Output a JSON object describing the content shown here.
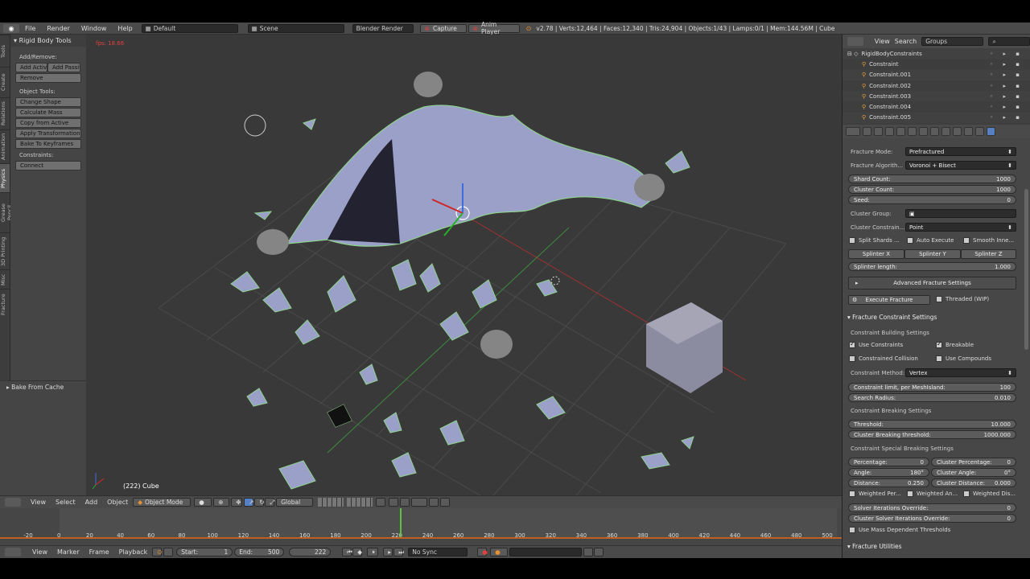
{
  "topbar": {
    "menus": [
      "File",
      "Render",
      "Window",
      "Help"
    ],
    "layout": "Default",
    "scene": "Scene",
    "engine": "Blender Render",
    "capture": "Capture",
    "anim_player": "Anim Player",
    "stats": "v2.78 | Verts:12,464 | Faces:12,340 | Tris:24,904 | Objects:1/43 | Lamps:0/1 | Mem:144.56M | Cube"
  },
  "vtabs": [
    "Tools",
    "Create",
    "Relations",
    "Animation",
    "Physics",
    "Grease Pencil",
    "3D Printing",
    "Misc",
    "Fracture"
  ],
  "toolshelf": {
    "title": "Rigid Body Tools",
    "addremove_label": "Add/Remove:",
    "add_active": "Add Activ",
    "add_passive": "Add Passiv",
    "remove": "Remove",
    "object_tools_label": "Object Tools:",
    "object_tools": [
      "Change Shape",
      "Calculate Mass",
      "Copy from Active",
      "Apply Transformation",
      "Bake To Keyframes"
    ],
    "constraints_label": "Constraints:",
    "connect": "Connect",
    "bake_cache": "Bake From Cache"
  },
  "viewport": {
    "fps": "fps: 18.66",
    "object_label": "(222) Cube"
  },
  "viewheader": {
    "menus": [
      "View",
      "Select",
      "Add",
      "Object"
    ],
    "mode": "Object Mode",
    "orientation": "Global"
  },
  "timeline": {
    "ticks": [
      "-20",
      "0",
      "20",
      "40",
      "60",
      "80",
      "100",
      "120",
      "140",
      "160",
      "180",
      "200",
      "220",
      "240",
      "260",
      "280",
      "300",
      "320",
      "340",
      "360",
      "380",
      "400",
      "420",
      "440",
      "460",
      "480",
      "500"
    ],
    "menus": [
      "View",
      "Marker",
      "Frame",
      "Playback"
    ],
    "start_label": "Start:",
    "start": "1",
    "end_label": "End:",
    "end": "500",
    "current": "222",
    "sync": "No Sync"
  },
  "outliner": {
    "menus": [
      "View",
      "Search"
    ],
    "filter": "Groups",
    "rows": [
      "RigidBodyConstraints",
      "Constraint",
      "Constraint.001",
      "Constraint.002",
      "Constraint.003",
      "Constraint.004",
      "Constraint.005"
    ]
  },
  "props": {
    "fracture_mode_label": "Fracture Mode:",
    "fracture_mode": "Prefractured",
    "fracture_algo_label": "Fracture Algorith...",
    "fracture_algo": "Voronoi + Bisect",
    "shard_count_label": "Shard Count:",
    "shard_count": "1000",
    "cluster_count_label": "Cluster Count:",
    "cluster_count": "1000",
    "seed_label": "Seed:",
    "seed": "0",
    "cluster_group_label": "Cluster Group:",
    "cluster_constraint_label": "Cluster Constrain...",
    "cluster_constraint": "Point",
    "split_shards": "Split Shards ...",
    "auto_execute": "Auto Execute",
    "smooth_inner": "Smooth Inne...",
    "splinter_x": "Splinter X",
    "splinter_y": "Splinter Y",
    "splinter_z": "Splinter Z",
    "splinter_length_label": "Splinter length:",
    "splinter_length": "1.000",
    "advanced": "Advanced Fracture Settings",
    "execute": "Execute Fracture",
    "threaded": "Threaded (WIP)",
    "constraint_settings": "Fracture Constraint Settings",
    "building_settings": "Constraint Building Settings",
    "use_constraints": "Use Constraints",
    "breakable": "Breakable",
    "constrained_collision": "Constrained Collision",
    "use_compounds": "Use Compounds",
    "constraint_method_label": "Constraint Method:",
    "constraint_method": "Vertex",
    "constraint_limit_label": "Constraint limit, per MeshIsland:",
    "constraint_limit": "100",
    "search_radius_label": "Search Radius:",
    "search_radius": "0.010",
    "breaking_settings": "Constraint Breaking Settings",
    "threshold_label": "Threshold:",
    "threshold": "10.000",
    "cluster_threshold_label": "Cluster Breaking threshold:",
    "cluster_threshold": "1000.000",
    "special_settings": "Constraint Special Breaking Settings",
    "percentage_label": "Percentage:",
    "percentage": "0",
    "cluster_percentage_label": "Cluster Percentage:",
    "cluster_percentage": "0",
    "angle_label": "Angle:",
    "angle": "180°",
    "cluster_angle_label": "Cluster Angle:",
    "cluster_angle": "0°",
    "distance_label": "Distance:",
    "distance": "0.250",
    "cluster_distance_label": "Cluster Distance:",
    "cluster_distance": "0.000",
    "weighted_per": "Weighted Per...",
    "weighted_an": "Weighted An...",
    "weighted_dis": "Weighted Dis...",
    "solver_iter_label": "Solver Iterations Override:",
    "solver_iter": "0",
    "cluster_solver_iter_label": "Cluster Solver Iterations Override:",
    "cluster_solver_iter": "0",
    "mass_dependent": "Use Mass Dependent Thresholds",
    "fracture_utilities": "Fracture Utilities"
  },
  "colors": {
    "accent": "#5680c2",
    "shard_edge": "#8fd18f",
    "mesh": "#9aa0c8",
    "cube": "#8c8ca0",
    "current_frame": "#60c040"
  }
}
